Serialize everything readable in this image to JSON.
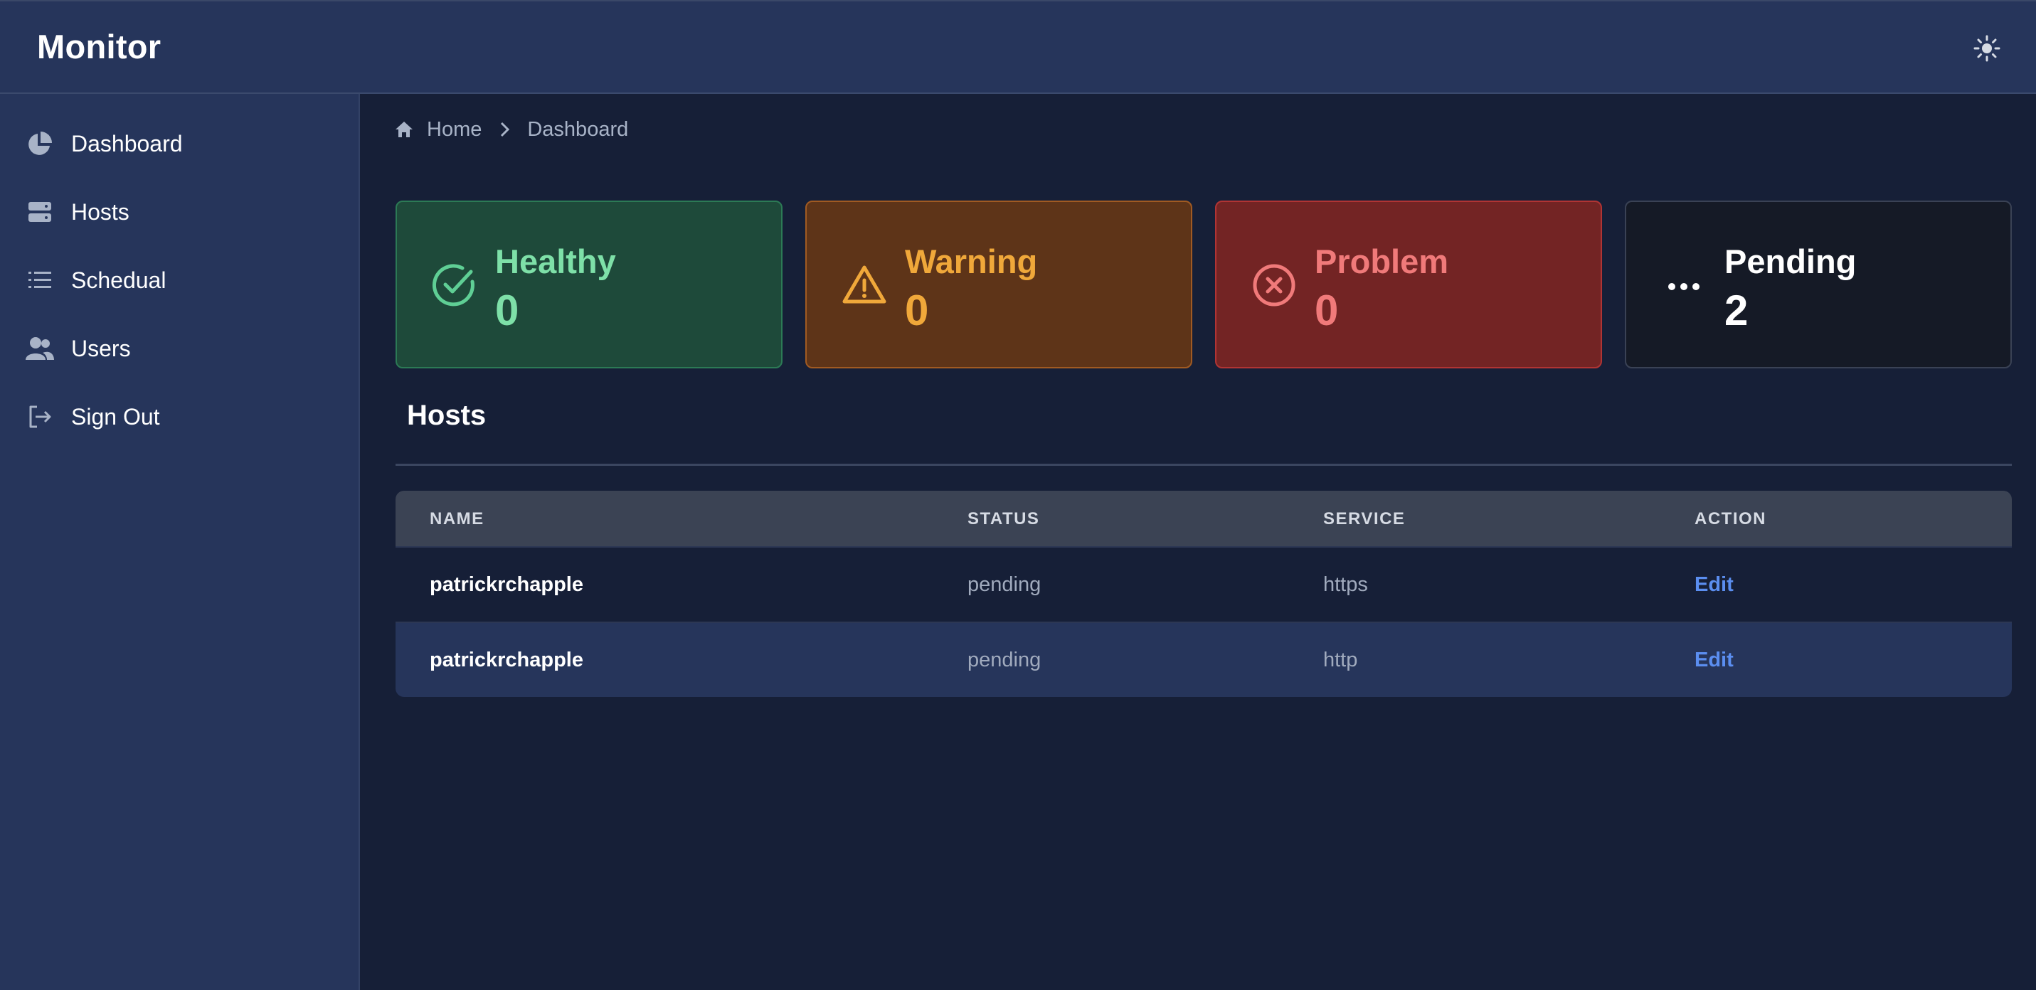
{
  "app": {
    "title": "Monitor"
  },
  "sidebar": {
    "items": [
      {
        "label": "Dashboard"
      },
      {
        "label": "Hosts"
      },
      {
        "label": "Schedual"
      },
      {
        "label": "Users"
      },
      {
        "label": "Sign Out"
      }
    ]
  },
  "breadcrumb": {
    "home": "Home",
    "current": "Dashboard"
  },
  "stats": [
    {
      "label": "Healthy",
      "value": "0",
      "color": "#7ee0a8"
    },
    {
      "label": "Warning",
      "value": "0",
      "color": "#f0a83a"
    },
    {
      "label": "Problem",
      "value": "0",
      "color": "#f07a7a"
    },
    {
      "label": "Pending",
      "value": "2",
      "color": "#ffffff"
    }
  ],
  "hosts": {
    "title": "Hosts",
    "columns": [
      "NAME",
      "STATUS",
      "SERVICE",
      "ACTION"
    ],
    "rows": [
      {
        "name": "patrickrchapple",
        "status": "pending",
        "service": "https",
        "action": "Edit"
      },
      {
        "name": "patrickrchapple",
        "status": "pending",
        "service": "http",
        "action": "Edit"
      }
    ]
  }
}
